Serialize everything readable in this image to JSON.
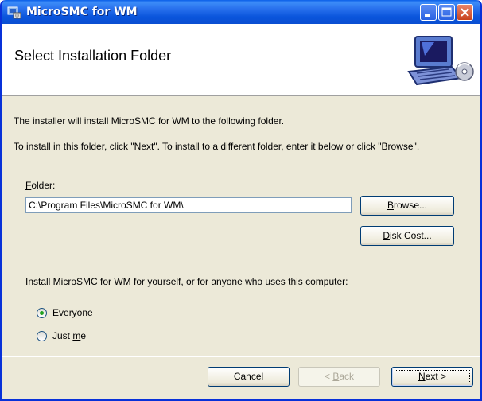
{
  "window": {
    "title": "MicroSMC for WM"
  },
  "header": {
    "title": "Select Installation Folder"
  },
  "body": {
    "intro": "The installer will install MicroSMC for WM to the following folder.",
    "instructions": "To install in this folder, click \"Next\". To install to a different folder, enter it below or click \"Browse\"."
  },
  "folder": {
    "label_accel": "F",
    "label_rest": "older:",
    "value": "C:\\Program Files\\MicroSMC for WM\\"
  },
  "buttons": {
    "browse_accel": "B",
    "browse_rest": "rowse...",
    "disk_accel": "D",
    "disk_rest": "isk Cost...",
    "cancel": "Cancel",
    "back_pre": "< ",
    "back_accel": "B",
    "back_rest": "ack",
    "next_accel": "N",
    "next_rest": "ext >"
  },
  "install_for": {
    "question": "Install MicroSMC for WM for yourself, or for anyone who uses this computer:",
    "options": [
      {
        "pre": "",
        "accel": "E",
        "rest": "veryone",
        "selected": true
      },
      {
        "pre": "Just ",
        "accel": "m",
        "rest": "e",
        "selected": false
      }
    ]
  },
  "icons": [
    "installer-icon",
    "minimize-icon",
    "maximize-icon",
    "close-icon",
    "computer-disk-icon"
  ]
}
